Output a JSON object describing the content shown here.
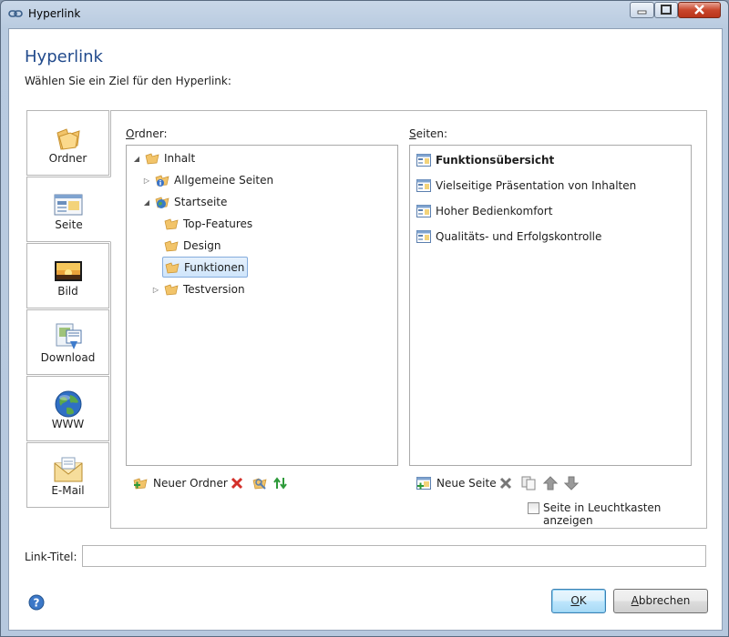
{
  "window": {
    "title": "Hyperlink"
  },
  "dialog": {
    "heading": "Hyperlink",
    "subheading": "Wählen Sie ein Ziel für den Hyperlink:"
  },
  "tabs": [
    {
      "label": "Ordner",
      "icon": "folder-icon"
    },
    {
      "label": "Seite",
      "icon": "page-icon",
      "active": true
    },
    {
      "label": "Bild",
      "icon": "image-icon"
    },
    {
      "label": "Download",
      "icon": "download-icon"
    },
    {
      "label": "WWW",
      "icon": "globe-icon"
    },
    {
      "label": "E-Mail",
      "icon": "envelope-icon"
    }
  ],
  "folders": {
    "label_prefix": "O",
    "label_rest": "rdner:",
    "tree": [
      {
        "label": "Inhalt",
        "expander": "open"
      },
      {
        "label": "Allgemeine Seiten",
        "expander": "closed"
      },
      {
        "label": "Startseite",
        "expander": "open"
      },
      {
        "label": "Top-Features",
        "expander": ""
      },
      {
        "label": "Design",
        "expander": ""
      },
      {
        "label": "Funktionen",
        "expander": "",
        "selected": true
      },
      {
        "label": "Testversion",
        "expander": "closed"
      }
    ],
    "toolbar": {
      "new_folder_label": "Neuer Ordner"
    }
  },
  "pages": {
    "label_prefix": "S",
    "label_rest": "eiten:",
    "items": [
      {
        "label": "Funktionsübersicht",
        "bold": true
      },
      {
        "label": "Vielseitige Präsentation von Inhalten"
      },
      {
        "label": "Hoher Bedienkomfort"
      },
      {
        "label": "Qualitäts- und Erfolgskontrolle"
      }
    ],
    "toolbar": {
      "new_page_label": "Neue Seite"
    },
    "lightbox_checkbox_label": "Seite in Leuchtkasten anzeigen",
    "lightbox_checked": false
  },
  "link_title": {
    "label": "Link-Titel:",
    "value": ""
  },
  "buttons": {
    "ok_prefix": "O",
    "ok_rest": "K",
    "cancel_prefix": "A",
    "cancel_rest": "bbrechen"
  },
  "colors": {
    "heading": "#214a8c",
    "selection_border": "#84acdd",
    "default_button": "#3c7fb1",
    "close_button": "#c9462c"
  }
}
